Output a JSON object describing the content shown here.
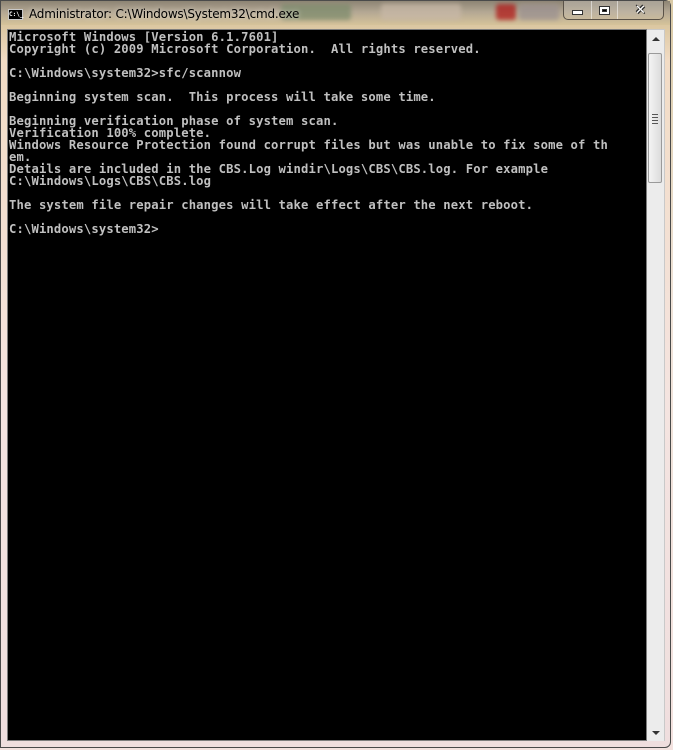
{
  "window": {
    "title": "Administrator: C:\\Windows\\System32\\cmd.exe",
    "icon": "cmd-prompt-icon",
    "icon_label": "C:\\_",
    "caption_buttons": {
      "minimize": "minimize-icon",
      "maximize": "maximize-icon",
      "close": "close-icon",
      "close_glyph": "✕"
    }
  },
  "console": {
    "background": "#000000",
    "foreground": "#c0c0c0",
    "lines": [
      "Microsoft Windows [Version 6.1.7601]",
      "Copyright (c) 2009 Microsoft Corporation.  All rights reserved.",
      "",
      "C:\\Windows\\system32>sfc/scannow",
      "",
      "Beginning system scan.  This process will take some time.",
      "",
      "Beginning verification phase of system scan.",
      "Verification 100% complete.",
      "Windows Resource Protection found corrupt files but was unable to fix some of th",
      "em.",
      "Details are included in the CBS.Log windir\\Logs\\CBS\\CBS.log. For example",
      "C:\\Windows\\Logs\\CBS\\CBS.log",
      "",
      "The system file repair changes will take effect after the next reboot.",
      "",
      "C:\\Windows\\system32>"
    ]
  },
  "scrollbar": {
    "position_fraction": 0.0,
    "up_icon": "scroll-up-arrow-icon",
    "down_icon": "scroll-down-arrow-icon"
  }
}
